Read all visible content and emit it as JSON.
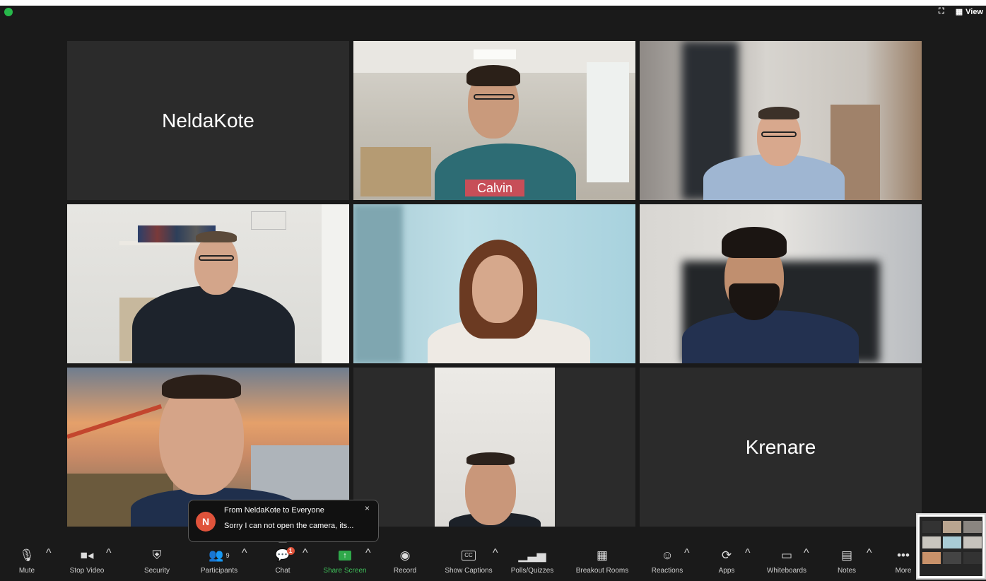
{
  "top_right": {
    "view_label": "View"
  },
  "tiles": {
    "nelda": {
      "name": "NeldaKote"
    },
    "krenare": {
      "name": "Krenare"
    },
    "calvin_shirt": "Calvin"
  },
  "chat_notification": {
    "avatar_initial": "N",
    "from": "From NeldaKote to Everyone",
    "message": "Sorry I can not open the camera, its..."
  },
  "toolbar": {
    "mute": "Mute",
    "stop_video": "Stop Video",
    "security": "Security",
    "participants": "Participants",
    "participants_count": "9",
    "chat": "Chat",
    "chat_badge": "1",
    "share_screen": "Share Screen",
    "record": "Record",
    "show_captions": "Show Captions",
    "cc": "CC",
    "polls": "Polls/Quizzes",
    "breakout": "Breakout Rooms",
    "reactions": "Reactions",
    "apps": "Apps",
    "whiteboards": "Whiteboards",
    "notes": "Notes",
    "more": "More"
  },
  "colors": {
    "active_speaker": "#3fb35b",
    "share_green": "#2fa84a",
    "badge_red": "#e0533b",
    "tile_bg": "#2b2b2b",
    "app_bg": "#1a1a1a"
  }
}
